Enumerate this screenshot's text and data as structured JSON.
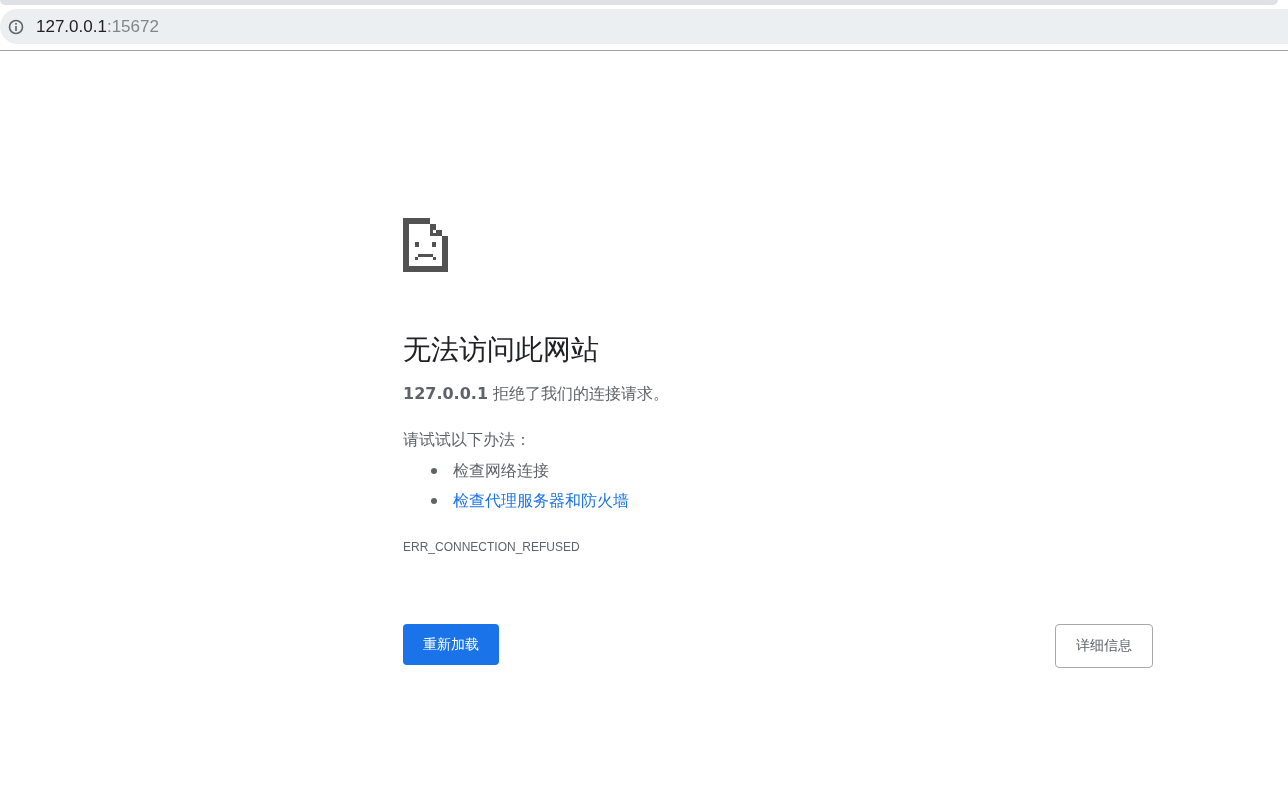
{
  "address_bar": {
    "host": "127.0.0.1",
    "port": ":15672"
  },
  "error": {
    "title": "无法访问此网站",
    "message": "**127.0.0.1** 拒绝了我们的连接请求。",
    "suggestions_intro": "请试试以下办法：",
    "suggestions": [
      {
        "kind": "text",
        "text": "检查网络连接"
      },
      {
        "kind": "link",
        "text": "检查代理服务器和防火墙"
      }
    ],
    "code": "ERR_CONNECTION_REFUSED"
  },
  "buttons": [
    {
      "kind": "primary",
      "label": "重新加载"
    },
    {
      "kind": "secondary",
      "label": "详细信息"
    }
  ]
}
